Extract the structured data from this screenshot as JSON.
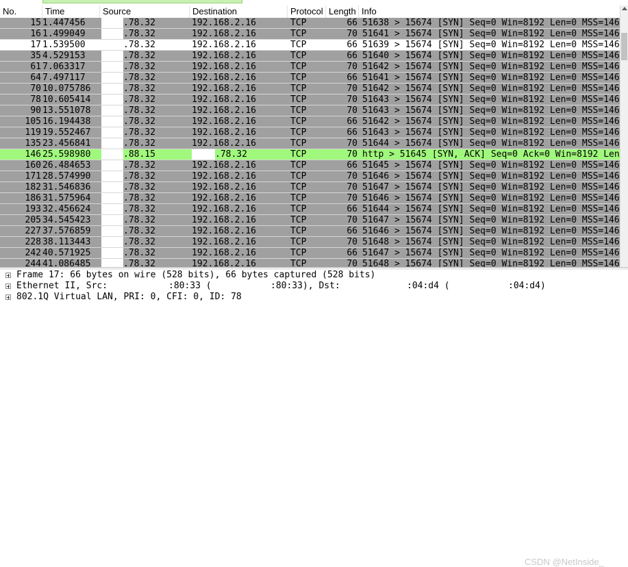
{
  "colors": {
    "syn_row_bg": "#a0a0a0",
    "selected_row_bg": "#ffffff",
    "synack_row_bg": "#a0f87c",
    "row_text": "#000000",
    "header_bg": "#ffffff"
  },
  "columns": [
    "No.",
    "Time",
    "Source",
    "Destination",
    "Protocol",
    "Length",
    "Info"
  ],
  "rows": [
    {
      "no": "15",
      "time": "1.447456",
      "src": ".78.32",
      "dst": "192.168.2.16",
      "proto": "TCP",
      "len": "66",
      "info": "51638 > 15674 [SYN] Seq=0 Win=8192 Len=0 MSS=146",
      "style": "syn"
    },
    {
      "no": "16",
      "time": "1.499049",
      "src": ".78.32",
      "dst": "192.168.2.16",
      "proto": "TCP",
      "len": "70",
      "info": "51641 > 15674 [SYN] Seq=0 Win=8192 Len=0 MSS=146",
      "style": "syn"
    },
    {
      "no": "17",
      "time": "1.539500",
      "src": ".78.32",
      "dst": "192.168.2.16",
      "proto": "TCP",
      "len": "66",
      "info": "51639 > 15674 [SYN] Seq=0 Win=8192 Len=0 MSS=146",
      "style": "selected"
    },
    {
      "no": "35",
      "time": "4.529153",
      "src": ".78.32",
      "dst": "192.168.2.16",
      "proto": "TCP",
      "len": "66",
      "info": "51640 > 15674 [SYN] Seq=0 Win=8192 Len=0 MSS=146",
      "style": "syn"
    },
    {
      "no": "61",
      "time": "7.063317",
      "src": ".78.32",
      "dst": "192.168.2.16",
      "proto": "TCP",
      "len": "70",
      "info": "51642 > 15674 [SYN] Seq=0 Win=8192 Len=0 MSS=146",
      "style": "syn"
    },
    {
      "no": "64",
      "time": "7.497117",
      "src": ".78.32",
      "dst": "192.168.2.16",
      "proto": "TCP",
      "len": "66",
      "info": "51641 > 15674 [SYN] Seq=0 Win=8192 Len=0 MSS=146",
      "style": "syn"
    },
    {
      "no": "70",
      "time": "10.075786",
      "src": ".78.32",
      "dst": "192.168.2.16",
      "proto": "TCP",
      "len": "70",
      "info": "51642 > 15674 [SYN] Seq=0 Win=8192 Len=0 MSS=146",
      "style": "syn"
    },
    {
      "no": "78",
      "time": "10.605414",
      "src": ".78.32",
      "dst": "192.168.2.16",
      "proto": "TCP",
      "len": "70",
      "info": "51643 > 15674 [SYN] Seq=0 Win=8192 Len=0 MSS=146",
      "style": "syn"
    },
    {
      "no": "90",
      "time": "13.551078",
      "src": ".78.32",
      "dst": "192.168.2.16",
      "proto": "TCP",
      "len": "70",
      "info": "51643 > 15674 [SYN] Seq=0 Win=8192 Len=0 MSS=146",
      "style": "syn"
    },
    {
      "no": "105",
      "time": "16.194438",
      "src": ".78.32",
      "dst": "192.168.2.16",
      "proto": "TCP",
      "len": "66",
      "info": "51642 > 15674 [SYN] Seq=0 Win=8192 Len=0 MSS=146",
      "style": "syn"
    },
    {
      "no": "119",
      "time": "19.552467",
      "src": ".78.32",
      "dst": "192.168.2.16",
      "proto": "TCP",
      "len": "66",
      "info": "51643 > 15674 [SYN] Seq=0 Win=8192 Len=0 MSS=146",
      "style": "syn"
    },
    {
      "no": "135",
      "time": "23.456841",
      "src": ".78.32",
      "dst": "192.168.2.16",
      "proto": "TCP",
      "len": "70",
      "info": "51644 > 15674 [SYN] Seq=0 Win=8192 Len=0 MSS=146",
      "style": "syn"
    },
    {
      "no": "146",
      "time": "25.598980",
      "src": ".88.15",
      "dst": ".78.32",
      "proto": "TCP",
      "len": "70",
      "info": "http > 51645 [SYN, ACK] Seq=0 Ack=0 Win=8192 Len",
      "style": "synack"
    },
    {
      "no": "160",
      "time": "26.484653",
      "src": ".78.32",
      "dst": "192.168.2.16",
      "proto": "TCP",
      "len": "66",
      "info": "51645 > 15674 [SYN] Seq=0 Win=8192 Len=0 MSS=146",
      "style": "syn"
    },
    {
      "no": "171",
      "time": "28.574990",
      "src": ".78.32",
      "dst": "192.168.2.16",
      "proto": "TCP",
      "len": "70",
      "info": "51646 > 15674 [SYN] Seq=0 Win=8192 Len=0 MSS=146",
      "style": "syn"
    },
    {
      "no": "182",
      "time": "31.546836",
      "src": ".78.32",
      "dst": "192.168.2.16",
      "proto": "TCP",
      "len": "70",
      "info": "51647 > 15674 [SYN] Seq=0 Win=8192 Len=0 MSS=146",
      "style": "syn"
    },
    {
      "no": "186",
      "time": "31.575964",
      "src": ".78.32",
      "dst": "192.168.2.16",
      "proto": "TCP",
      "len": "70",
      "info": "51646 > 15674 [SYN] Seq=0 Win=8192 Len=0 MSS=146",
      "style": "syn"
    },
    {
      "no": "193",
      "time": "32.456624",
      "src": ".78.32",
      "dst": "192.168.2.16",
      "proto": "TCP",
      "len": "66",
      "info": "51644 > 15674 [SYN] Seq=0 Win=8192 Len=0 MSS=146",
      "style": "syn"
    },
    {
      "no": "205",
      "time": "34.545423",
      "src": ".78.32",
      "dst": "192.168.2.16",
      "proto": "TCP",
      "len": "70",
      "info": "51647 > 15674 [SYN] Seq=0 Win=8192 Len=0 MSS=146",
      "style": "syn"
    },
    {
      "no": "227",
      "time": "37.576859",
      "src": ".78.32",
      "dst": "192.168.2.16",
      "proto": "TCP",
      "len": "66",
      "info": "51646 > 15674 [SYN] Seq=0 Win=8192 Len=0 MSS=146",
      "style": "syn"
    },
    {
      "no": "228",
      "time": "38.113443",
      "src": ".78.32",
      "dst": "192.168.2.16",
      "proto": "TCP",
      "len": "70",
      "info": "51648 > 15674 [SYN] Seq=0 Win=8192 Len=0 MSS=146",
      "style": "syn"
    },
    {
      "no": "242",
      "time": "40.571925",
      "src": ".78.32",
      "dst": "192.168.2.16",
      "proto": "TCP",
      "len": "66",
      "info": "51647 > 15674 [SYN] Seq=0 Win=8192 Len=0 MSS=146",
      "style": "syn"
    },
    {
      "no": "244",
      "time": "41.086485",
      "src": ".78.32",
      "dst": "192.168.2.16",
      "proto": "TCP",
      "len": "70",
      "info": "51648 > 15674 [SYN] Seq=0 Win=8192 Len=0 MSS=146",
      "style": "syn"
    }
  ],
  "details": {
    "frame": "Frame 17: 66 bytes on wire (528 bits), 66 bytes captured (528 bits)",
    "ethernet_prefix": "Ethernet II, Src:",
    "ethernet_src_tail": ":80:33 (",
    "ethernet_src_tail2": ":80:33), Dst:",
    "ethernet_dst_tail": ":04:d4 (",
    "ethernet_dst_tail2": ":04:d4)",
    "vlan": "802.1Q Virtual LAN, PRI: 0, CFI: 0, ID: 78"
  },
  "watermark": "CSDN @NetInside_"
}
